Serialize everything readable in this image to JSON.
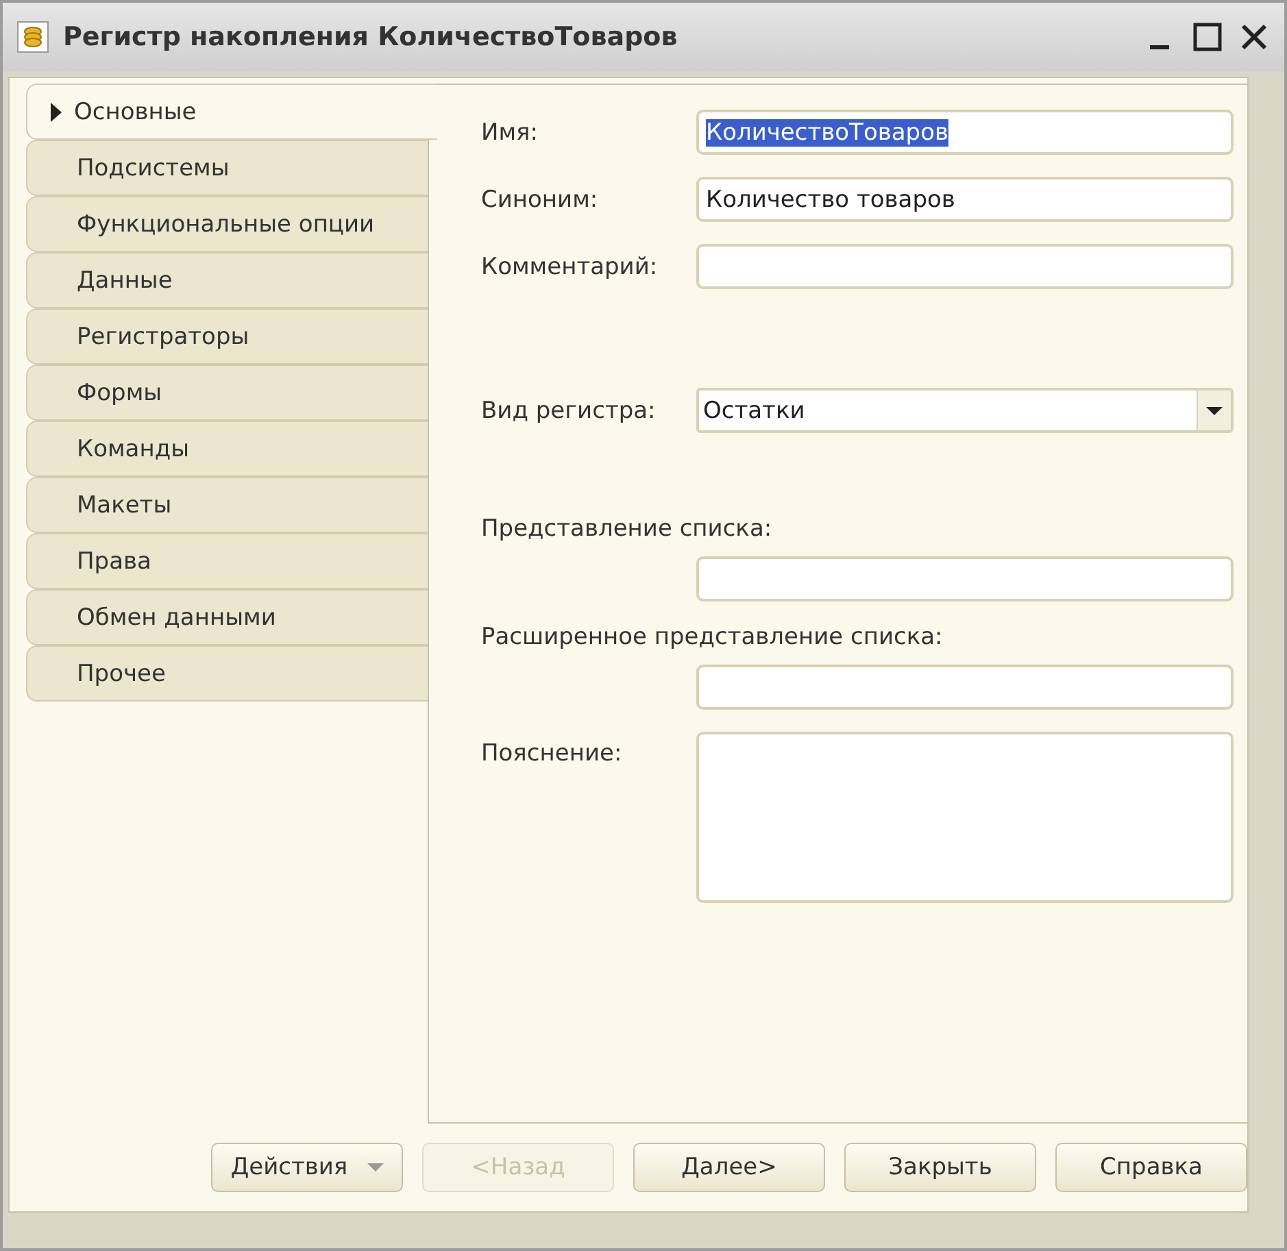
{
  "window": {
    "title": "Регистр накопления КоличествоТоваров"
  },
  "tabs": [
    {
      "label": "Основные",
      "selected": true
    },
    {
      "label": "Подсистемы",
      "selected": false
    },
    {
      "label": "Функциональные опции",
      "selected": false
    },
    {
      "label": "Данные",
      "selected": false
    },
    {
      "label": "Регистраторы",
      "selected": false
    },
    {
      "label": "Формы",
      "selected": false
    },
    {
      "label": "Команды",
      "selected": false
    },
    {
      "label": "Макеты",
      "selected": false
    },
    {
      "label": "Права",
      "selected": false
    },
    {
      "label": "Обмен данными",
      "selected": false
    },
    {
      "label": "Прочее",
      "selected": false
    }
  ],
  "fields": [
    {
      "kind": "inline",
      "label": "Имя:",
      "value": "КоличествоТоваров",
      "value_selected": true
    },
    {
      "kind": "inline",
      "label": "Синоним:",
      "value": "Количество товаров",
      "value_selected": false
    },
    {
      "kind": "inline",
      "label": "Комментарий:"
    },
    {
      "kind": "select",
      "label": "Вид регистра:",
      "value": "Остатки"
    },
    {
      "kind": "stacked",
      "label": "Представление списка:"
    },
    {
      "kind": "stacked",
      "label": "Расширенное представление списка:"
    },
    {
      "kind": "memo",
      "label": "Пояснение:"
    }
  ],
  "buttons": [
    {
      "label": "Действия",
      "kind": "menu",
      "disabled": false
    },
    {
      "label": "<Назад",
      "kind": "plain",
      "disabled": true
    },
    {
      "label": "Далее>",
      "kind": "plain",
      "disabled": false
    },
    {
      "label": "Закрыть",
      "kind": "plain",
      "disabled": false
    },
    {
      "label": "Справка",
      "kind": "plain",
      "disabled": false
    }
  ]
}
